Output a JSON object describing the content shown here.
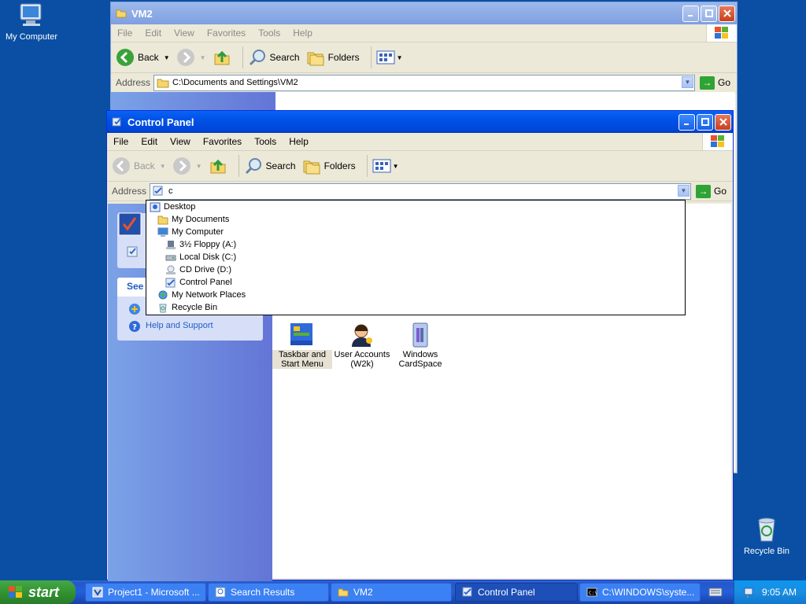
{
  "desktop": {
    "icons": [
      {
        "label": "My Computer"
      },
      {
        "label": "Recycle Bin"
      }
    ]
  },
  "back_window": {
    "title": "VM2",
    "menu": [
      "File",
      "Edit",
      "View",
      "Favorites",
      "Tools",
      "Help"
    ],
    "toolbar": {
      "back": "Back",
      "search": "Search",
      "folders": "Folders"
    },
    "address_label": "Address",
    "address_value": "C:\\Documents and Settings\\VM2",
    "go": "Go"
  },
  "front_window": {
    "title": "Control Panel",
    "menu": [
      "File",
      "Edit",
      "View",
      "Favorites",
      "Tools",
      "Help"
    ],
    "toolbar": {
      "back": "Back",
      "search": "Search",
      "folders": "Folders"
    },
    "address_label": "Address",
    "address_value": "c",
    "go": "Go",
    "left_pane": {
      "see_also_title": "See",
      "help_link": "Help and Support"
    },
    "items": [
      {
        "label": "Taskbar and Start Menu"
      },
      {
        "label": "User Accounts (W2k)"
      },
      {
        "label": "Windows CardSpace"
      }
    ]
  },
  "address_dropdown": {
    "items": [
      {
        "label": "Desktop",
        "icon": "desktop-icon"
      },
      {
        "label": "My Documents",
        "icon": "folder-icon"
      },
      {
        "label": "My Computer",
        "icon": "computer-icon"
      },
      {
        "label": "3½ Floppy (A:)",
        "icon": "floppy-icon"
      },
      {
        "label": "Local Disk (C:)",
        "icon": "disk-icon"
      },
      {
        "label": "CD Drive (D:)",
        "icon": "cd-icon"
      },
      {
        "label": "Control Panel",
        "icon": "control-panel-icon"
      },
      {
        "label": "My Network Places",
        "icon": "network-icon"
      },
      {
        "label": "Recycle Bin",
        "icon": "recycle-bin-icon"
      }
    ]
  },
  "taskbar": {
    "start": "start",
    "tasks": [
      {
        "label": "Project1 - Microsoft ..."
      },
      {
        "label": "Search Results"
      },
      {
        "label": "VM2"
      },
      {
        "label": "Control Panel"
      },
      {
        "label": "C:\\WINDOWS\\syste..."
      }
    ],
    "clock": "9:05 AM"
  }
}
